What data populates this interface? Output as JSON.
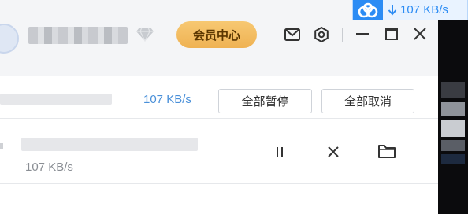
{
  "header": {
    "vip_label": "会员中心"
  },
  "speed_widget": {
    "speed": "107 KB/s",
    "accent": "#2c8cf4"
  },
  "toolbar": {
    "total_speed": "107 KB/s",
    "pause_all_label": "全部暂停",
    "cancel_all_label": "全部取消"
  },
  "tasks": [
    {
      "speed": "107 KB/s"
    }
  ],
  "icons": {
    "header": [
      "diamond-icon",
      "mail-icon",
      "settings-icon",
      "minimize-icon",
      "maximize-icon",
      "close-icon"
    ],
    "task_row": [
      "pause-icon",
      "cancel-icon",
      "folder-icon"
    ]
  },
  "colors": {
    "vip_gold": "#f0b656",
    "link_blue": "#4a90d9"
  }
}
